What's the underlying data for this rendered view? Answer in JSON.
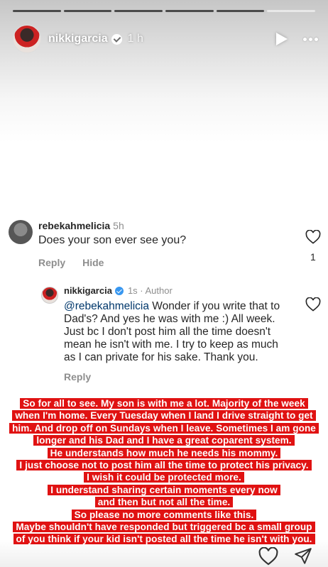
{
  "progress": [
    1,
    1,
    1,
    1,
    1,
    0
  ],
  "header": {
    "username": "nikkigarcia",
    "time": "1 h",
    "icons": [
      "verified-badge-icon",
      "play-icon",
      "more-icon"
    ]
  },
  "comment": {
    "username": "rebekahmelicia",
    "time": "5h",
    "text": "Does your son ever see you?",
    "reply_label": "Reply",
    "hide_label": "Hide",
    "like_count": "1"
  },
  "reply": {
    "username": "nikkigarcia",
    "meta": "1s · Author",
    "mention": "@rebekahmelicia",
    "text": " Wonder if you write that to Dad's? And yes he was with me :) All week. Just bc I don't post him all the time doesn't mean he isn't with me. I try to keep as much as I can private for his sake. Thank you.",
    "reply_label": "Reply"
  },
  "overlay_lines": [
    "So for all to see. My son is with me a lot. Majority of the week",
    "when I'm home. Every Tuesday when I land I drive straight to get",
    "him. And drop off on Sundays when I leave. Sometimes I am gone",
    "longer and his Dad and I have a great coparent system.",
    "He understands how much he needs his mommy.",
    "I just choose not to post him all the time to protect his privacy.",
    "I wish it could be protected more.",
    "I understand sharing certain moments every now",
    "and then but not all the time.",
    "So please no more comments like this.",
    "Maybe shouldn't have responded but triggered bc a small group",
    "of you think if your kid isn't posted all the time he isn't with you."
  ],
  "colors": {
    "highlight": "#e01212",
    "text": "#262626",
    "muted": "#8e8e8e"
  },
  "bottom_icons": [
    "heart-icon",
    "send-icon"
  ]
}
